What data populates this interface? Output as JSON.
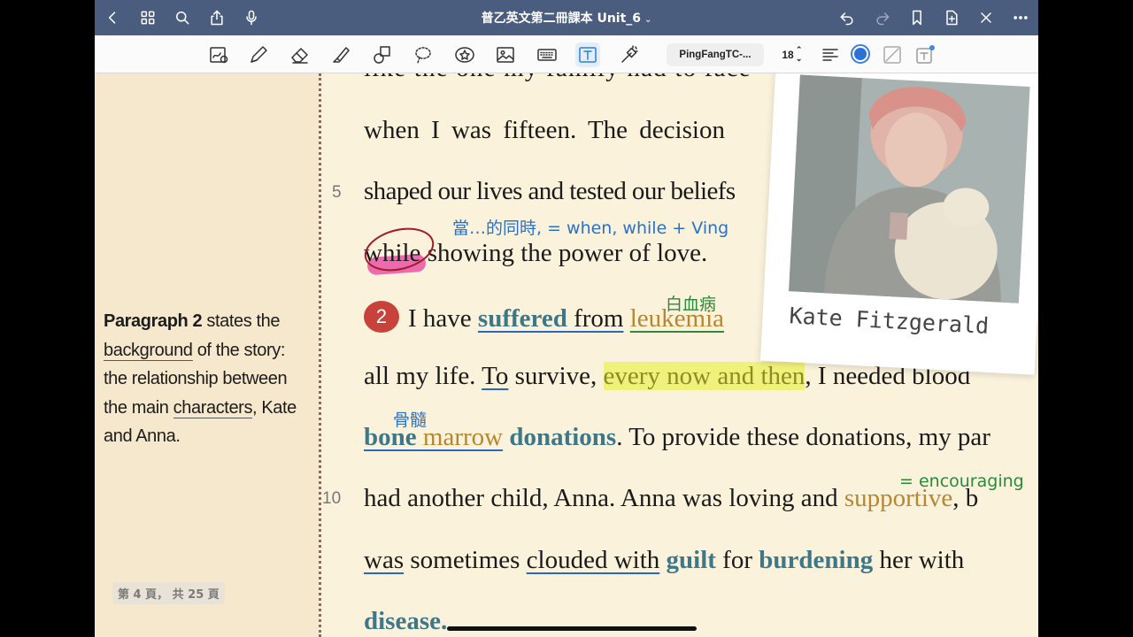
{
  "navbar": {
    "title": "普乙英文第二冊課本 Unit_6",
    "caret": "⌄"
  },
  "toolbar": {
    "font_name": "PingFangTC-...",
    "font_size": "18",
    "font_size_stepper": "⌃⌄",
    "selected_color": "#2a72d8"
  },
  "side_note": {
    "w1": "Paragraph 2",
    "w2": " states the ",
    "w3": "background",
    "w4": " of the story: the relationship between the main ",
    "w5": "characters",
    "w6": ", Kate and Anna."
  },
  "page_counter": "第 4 頁， 共 25 頁",
  "line_numbers": {
    "n5": "5",
    "n10": "10"
  },
  "text": {
    "l0": "like the one my family had to face",
    "l1": "when I was fifteen. The decision",
    "l2": "shaped our lives and tested our beliefs",
    "l3_a": "while",
    "l3_b": " showing the power of love.",
    "badge": "2",
    "l4_a": "I have ",
    "l4_b": "suffered",
    "l4_c": " from",
    "l4_d": " ",
    "l4_e": "leukemia",
    "l5_a": "all my life. ",
    "l5_b": "To",
    "l5_c": " survive, ",
    "l5_d": "every now and then",
    "l5_e": ", I needed blood",
    "l6_a": "bone",
    "l6_b": " marrow",
    "l6_c": " ",
    "l6_d": "donations",
    "l6_e": ". To provide these donations, my par",
    "l7_a": "had another child, Anna. Anna was loving and ",
    "l7_b": "supportive",
    "l7_c": ", b",
    "l8_a": "was",
    "l8_b": " sometimes ",
    "l8_c": "clouded with",
    "l8_d": " ",
    "l8_e": "guilt",
    "l8_f": " for ",
    "l8_g": "burdening",
    "l8_h": " her with",
    "l9": "disease."
  },
  "annotations": {
    "while_note": "當…的同時, = when, while + Ving",
    "leukemia_note": "白血病",
    "marrow_note": "骨髓",
    "supportive_note": "= encouraging"
  },
  "photo": {
    "caption": "Kate Fitzgerald"
  },
  "colors": {
    "navbar": "#4a5d7f",
    "annotation_blue": "#2a72c8",
    "annotation_green": "#2a8a3a",
    "vocab_teal": "#3e7888",
    "vocab_gold": "#b8862e",
    "badge_red": "#c8423c"
  }
}
